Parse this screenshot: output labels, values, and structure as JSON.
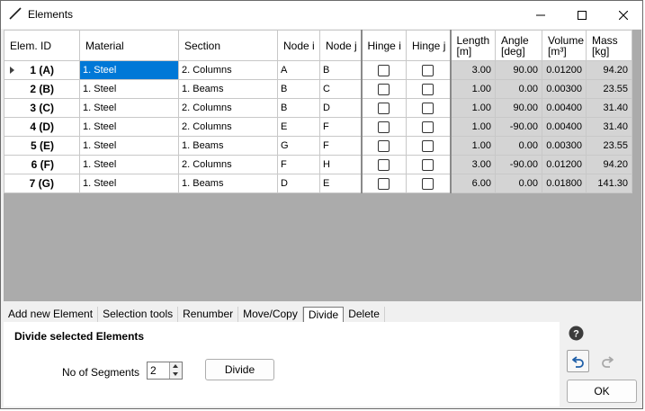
{
  "window": {
    "title": "Elements"
  },
  "columns": {
    "elem_id": "Elem. ID",
    "material": "Material",
    "section": "Section",
    "node_i": "Node i",
    "node_j": "Node j",
    "hinge_i": "Hinge i",
    "hinge_j": "Hinge j",
    "length": "Length",
    "length_unit": "[m]",
    "angle": "Angle",
    "angle_unit": "[deg]",
    "volume": "Volume",
    "volume_unit": "[m³]",
    "mass": "Mass",
    "mass_unit": "[kg]"
  },
  "rows": [
    {
      "id": "1 (A)",
      "material": "1. Steel",
      "section": "2. Columns",
      "node_i": "A",
      "node_j": "B",
      "length": "3.00",
      "angle": "90.00",
      "volume": "0.01200",
      "mass": "94.20"
    },
    {
      "id": "2 (B)",
      "material": "1. Steel",
      "section": "1. Beams",
      "node_i": "B",
      "node_j": "C",
      "length": "1.00",
      "angle": "0.00",
      "volume": "0.00300",
      "mass": "23.55"
    },
    {
      "id": "3 (C)",
      "material": "1. Steel",
      "section": "2. Columns",
      "node_i": "B",
      "node_j": "D",
      "length": "1.00",
      "angle": "90.00",
      "volume": "0.00400",
      "mass": "31.40"
    },
    {
      "id": "4 (D)",
      "material": "1. Steel",
      "section": "2. Columns",
      "node_i": "E",
      "node_j": "F",
      "length": "1.00",
      "angle": "-90.00",
      "volume": "0.00400",
      "mass": "31.40"
    },
    {
      "id": "5 (E)",
      "material": "1. Steel",
      "section": "1. Beams",
      "node_i": "G",
      "node_j": "F",
      "length": "1.00",
      "angle": "0.00",
      "volume": "0.00300",
      "mass": "23.55"
    },
    {
      "id": "6 (F)",
      "material": "1. Steel",
      "section": "2. Columns",
      "node_i": "F",
      "node_j": "H",
      "length": "3.00",
      "angle": "-90.00",
      "volume": "0.01200",
      "mass": "94.20"
    },
    {
      "id": "7 (G)",
      "material": "1. Steel",
      "section": "1. Beams",
      "node_i": "D",
      "node_j": "E",
      "length": "6.00",
      "angle": "0.00",
      "volume": "0.01800",
      "mass": "141.30"
    }
  ],
  "tabs": [
    "Add new Element",
    "Selection tools",
    "Renumber",
    "Move/Copy",
    "Divide",
    "Delete"
  ],
  "active_tab": "Divide",
  "panel": {
    "title": "Divide selected Elements",
    "segments_label": "No of Segments",
    "segments_value": "2",
    "divide_label": "Divide"
  },
  "ok_label": "OK",
  "colors": {
    "selection": "#0078d7",
    "computed_cell": "#d4d4d4",
    "grid_background": "#ababab",
    "help_icon": "#3c3c3c",
    "undo_icon": "#1f5fa8"
  },
  "icons": {
    "app": "line-element-icon",
    "help": "question-icon",
    "undo": "undo-icon",
    "redo": "redo-icon"
  }
}
